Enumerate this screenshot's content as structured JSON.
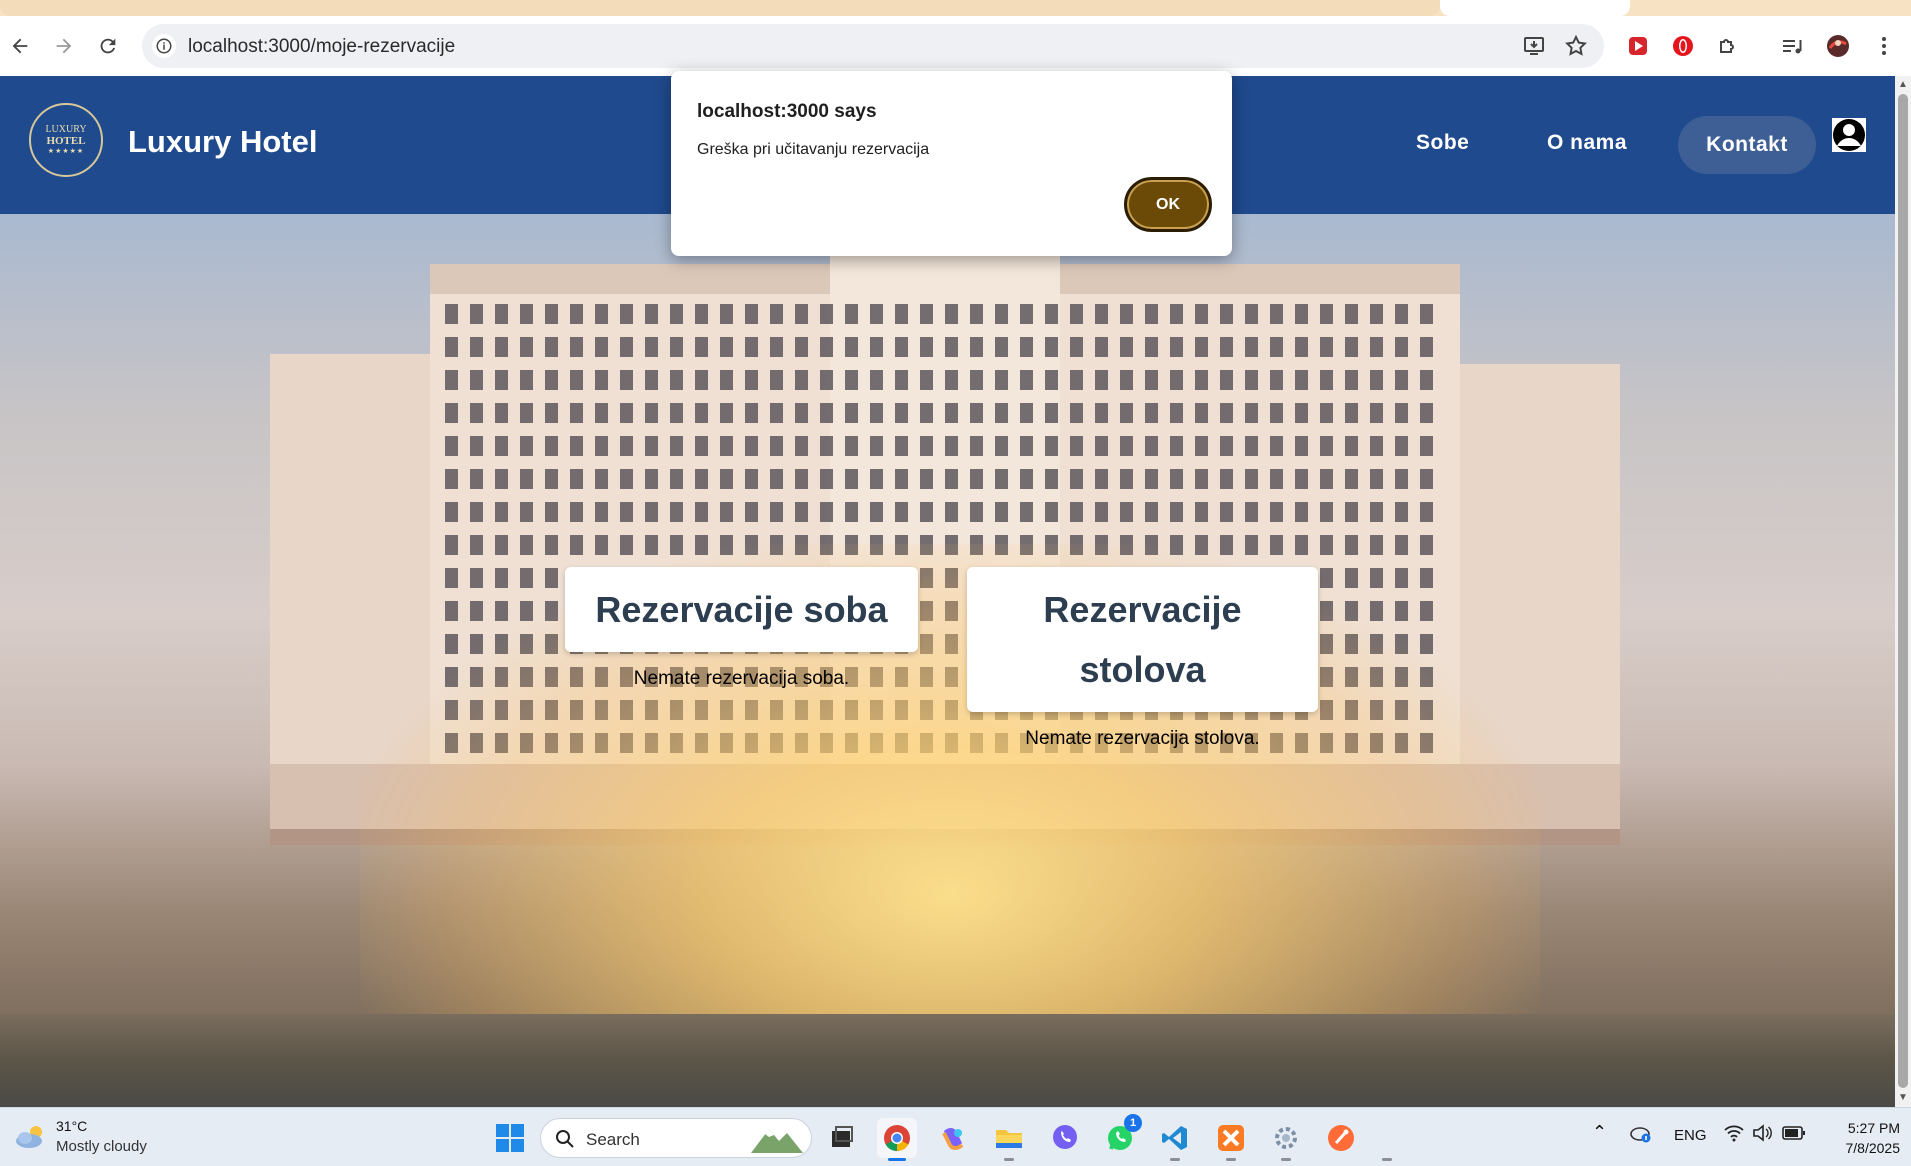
{
  "browser": {
    "url": "localhost:3000/moje-rezervacije"
  },
  "site": {
    "logo": {
      "line1": "LUXURY",
      "line2": "HOTEL",
      "stars": "★★★★★"
    },
    "brand": "Luxury Hotel",
    "nav": {
      "sobe": "Sobe",
      "o_nama": "O nama",
      "kontakt": "Kontakt"
    }
  },
  "reservations": {
    "rooms": {
      "title": "Rezervacije soba",
      "empty": "Nemate rezervacija soba."
    },
    "tables": {
      "title": "Rezervacije stolova",
      "empty": "Nemate rezervacija stolova."
    }
  },
  "alert": {
    "title": "localhost:3000 says",
    "message": "Greška pri učitavanju rezervacija",
    "ok": "OK"
  },
  "taskbar": {
    "weather": {
      "temp": "31°C",
      "condition": "Mostly cloudy"
    },
    "search_label": "Search",
    "whatsapp_badge": "1",
    "language": "ENG",
    "time": "5:27 PM",
    "date": "7/8/2025"
  },
  "colors": {
    "header_bg": "#1f4a8d",
    "ok_button": "#6b4a07",
    "card_title": "#2c3e50"
  }
}
